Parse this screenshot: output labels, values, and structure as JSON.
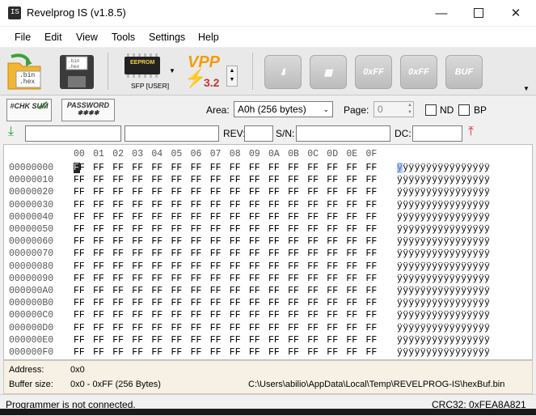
{
  "window": {
    "title": "Revelprog IS (v1.8.5)",
    "icon_text": "IS"
  },
  "menu": [
    "File",
    "Edit",
    "View",
    "Tools",
    "Settings",
    "Help"
  ],
  "toolbar": {
    "open_label": ".bin .hex",
    "chip_label": "EEPROM",
    "device_label": "SFP [USER]",
    "vpp_label": "VPP",
    "vpp_value": "3.2",
    "disabled_labels": [
      "0xFF",
      "0xFF",
      "BUF"
    ]
  },
  "options": {
    "checksum_label": "#CHK SUM",
    "password_label": "PASSWORD",
    "area_label": "Area:",
    "area_value": "A0h (256 bytes)",
    "page_label": "Page:",
    "page_value": "0",
    "nd_label": "ND",
    "bp_label": "BP"
  },
  "info": {
    "rev_label": "REV:",
    "sn_label": "S/N:",
    "dc_label": "DC:"
  },
  "hex": {
    "columns": [
      "00",
      "01",
      "02",
      "03",
      "04",
      "05",
      "06",
      "07",
      "08",
      "09",
      "0A",
      "0B",
      "0C",
      "0D",
      "0E",
      "0F"
    ],
    "addresses": [
      "00000000",
      "00000010",
      "00000020",
      "00000030",
      "00000040",
      "00000050",
      "00000060",
      "00000070",
      "00000080",
      "00000090",
      "000000A0",
      "000000B0",
      "000000C0",
      "000000D0",
      "000000E0",
      "000000F0"
    ],
    "byte_value": "FF",
    "ascii_line": "ÿÿÿÿÿÿÿÿÿÿÿÿÿÿÿÿ"
  },
  "details": {
    "address_label": "Address:",
    "address_value": "0x0",
    "buffer_label": "Buffer size:",
    "buffer_value": "0x0 - 0xFF (256 Bytes)",
    "path": "C:\\Users\\abilio\\AppData\\Local\\Temp\\REVELPROG-IS\\hexBuf.bin"
  },
  "status": {
    "message": "Programmer is not connected.",
    "crc": "CRC32: 0xFEA8A821"
  }
}
